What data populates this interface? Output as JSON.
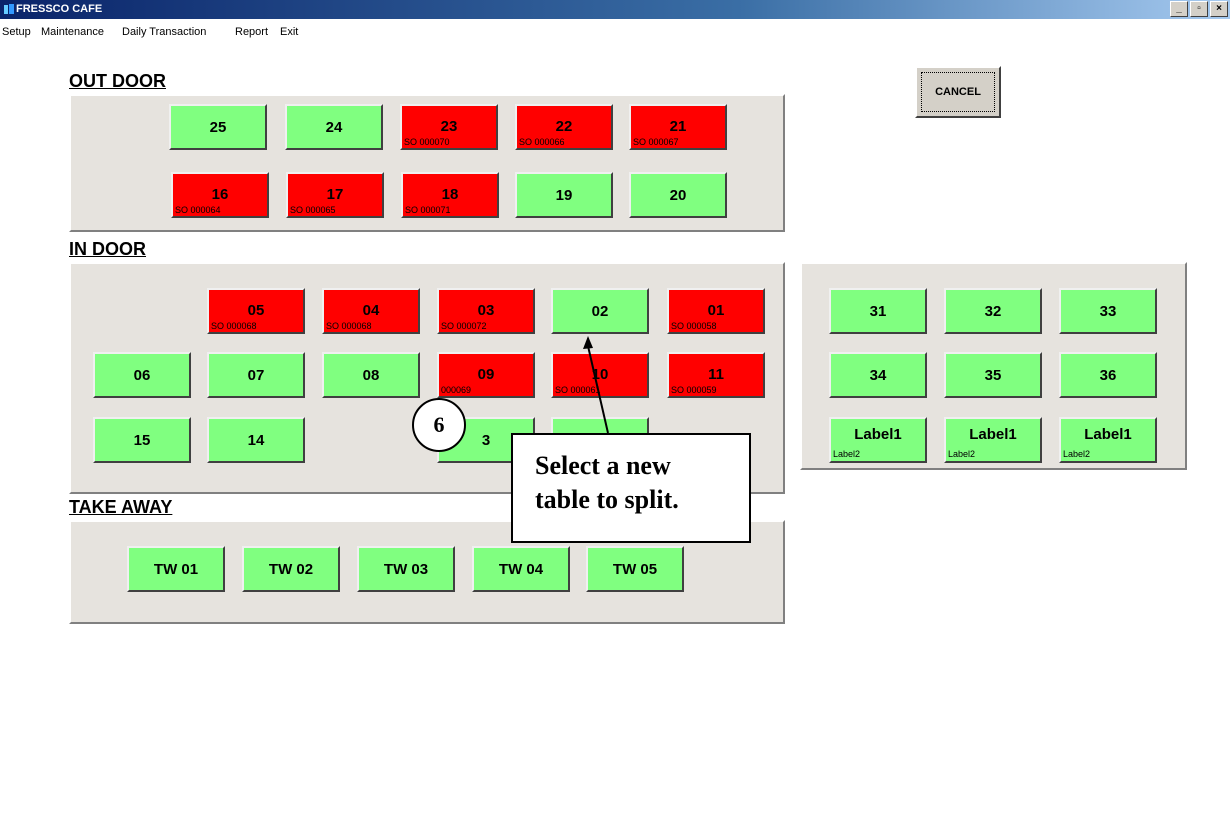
{
  "window": {
    "title": "FRESSCO CAFE",
    "minimize": "_",
    "maximize": "▫",
    "close": "×"
  },
  "menu": [
    "Setup",
    "Maintenance",
    "Daily Transaction",
    "Report",
    "Exit"
  ],
  "cancel_label": "CANCEL",
  "sections": {
    "outdoor": "OUT DOOR",
    "indoor": "IN DOOR",
    "takeaway": "TAKE AWAY"
  },
  "outdoor_tables": [
    {
      "num": "25",
      "status": "free",
      "so": ""
    },
    {
      "num": "24",
      "status": "free",
      "so": ""
    },
    {
      "num": "23",
      "status": "busy",
      "so": "SO 000070"
    },
    {
      "num": "22",
      "status": "busy",
      "so": "SO 000066"
    },
    {
      "num": "21",
      "status": "busy",
      "so": "SO 000067"
    },
    {
      "num": "16",
      "status": "busy",
      "so": "SO 000064"
    },
    {
      "num": "17",
      "status": "busy",
      "so": "SO 000065"
    },
    {
      "num": "18",
      "status": "busy",
      "so": "SO 000071"
    },
    {
      "num": "19",
      "status": "free",
      "so": ""
    },
    {
      "num": "20",
      "status": "free",
      "so": ""
    }
  ],
  "indoor_tables": [
    {
      "num": "05",
      "status": "busy",
      "so": "SO 000068"
    },
    {
      "num": "04",
      "status": "busy",
      "so": "SO 000068"
    },
    {
      "num": "03",
      "status": "busy",
      "so": "SO 000072"
    },
    {
      "num": "02",
      "status": "free",
      "so": ""
    },
    {
      "num": "01",
      "status": "busy",
      "so": "SO 000058"
    },
    {
      "num": "06",
      "status": "free",
      "so": ""
    },
    {
      "num": "07",
      "status": "free",
      "so": ""
    },
    {
      "num": "08",
      "status": "free",
      "so": ""
    },
    {
      "num": "09",
      "status": "busy",
      "so": "000069"
    },
    {
      "num": "10",
      "status": "busy",
      "so": "SO 000061"
    },
    {
      "num": "11",
      "status": "busy",
      "so": "SO 000059"
    },
    {
      "num": "15",
      "status": "free",
      "so": ""
    },
    {
      "num": "14",
      "status": "free",
      "so": ""
    },
    {
      "num": "3",
      "status": "free",
      "so": ""
    },
    {
      "num": "",
      "status": "free",
      "so": ""
    }
  ],
  "side_tables": [
    {
      "num": "31",
      "so": ""
    },
    {
      "num": "32",
      "so": ""
    },
    {
      "num": "33",
      "so": ""
    },
    {
      "num": "34",
      "so": ""
    },
    {
      "num": "35",
      "so": ""
    },
    {
      "num": "36",
      "so": ""
    },
    {
      "num": "Label1",
      "so": "Label2"
    },
    {
      "num": "Label1",
      "so": "Label2"
    },
    {
      "num": "Label1",
      "so": "Label2"
    }
  ],
  "takeaway_tables": [
    "TW 01",
    "TW 02",
    "TW 03",
    "TW 04",
    "TW 05"
  ],
  "callout": {
    "step": "6",
    "line1": "Select a new",
    "line2": "table to split."
  }
}
